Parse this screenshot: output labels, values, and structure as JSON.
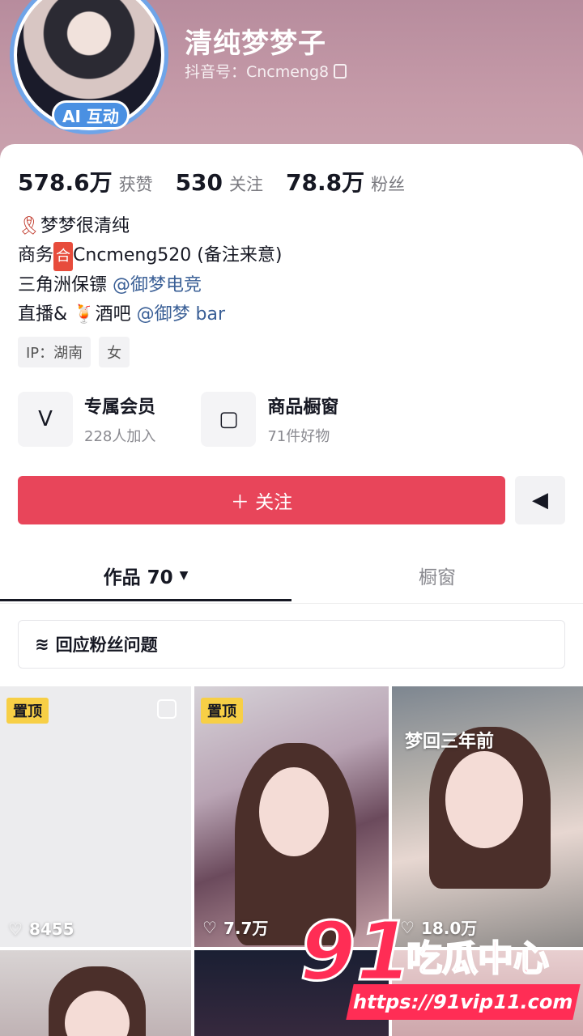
{
  "profile": {
    "nickname": "清纯梦梦子",
    "douyin_id": "抖音号：Cncmeng8",
    "ai_badge": "AI 互动"
  },
  "stats": [
    {
      "num": "578.6万",
      "label": "获赞"
    },
    {
      "num": "530",
      "label": "关注"
    },
    {
      "num": "78.8万",
      "label": "粉丝"
    }
  ],
  "bio": {
    "line1": "梦梦很清纯",
    "line2_prefix": "商务",
    "line2_box": "合",
    "line2_rest": "Cncmeng520 (备注来意)",
    "line3_prefix": "三角洲保镖 ",
    "line3_mention": "@御梦电竞",
    "line4_prefix": "直播& ",
    "line4_icon": "🍹",
    "line4_mid": "酒吧 ",
    "line4_mention": "@御梦 bar"
  },
  "tags": [
    "IP：湖南",
    "女"
  ],
  "services": [
    {
      "title": "专属会员",
      "sub": "228人加入",
      "icon": "V"
    },
    {
      "title": "商品橱窗",
      "sub": "71件好物",
      "icon": "▢"
    }
  ],
  "actions": {
    "follow_label": "＋ 关注",
    "share_icon": "◀"
  },
  "tabs": {
    "works": "作品 70",
    "shop": "橱窗"
  },
  "qa": {
    "label": "回应粉丝问题"
  },
  "videos": [
    {
      "pin": "置顶",
      "likes": "8455"
    },
    {
      "pin": "置顶",
      "likes": "7.7万"
    },
    {
      "caption": "梦回三年前",
      "likes": "18.0万"
    }
  ],
  "watermark": {
    "number": "91",
    "text": "吃瓜中心",
    "url": "https://91vip11.com"
  },
  "colors": {
    "accent": "#e8455a",
    "mention": "#3a5f96",
    "pin": "#f7cf46"
  }
}
